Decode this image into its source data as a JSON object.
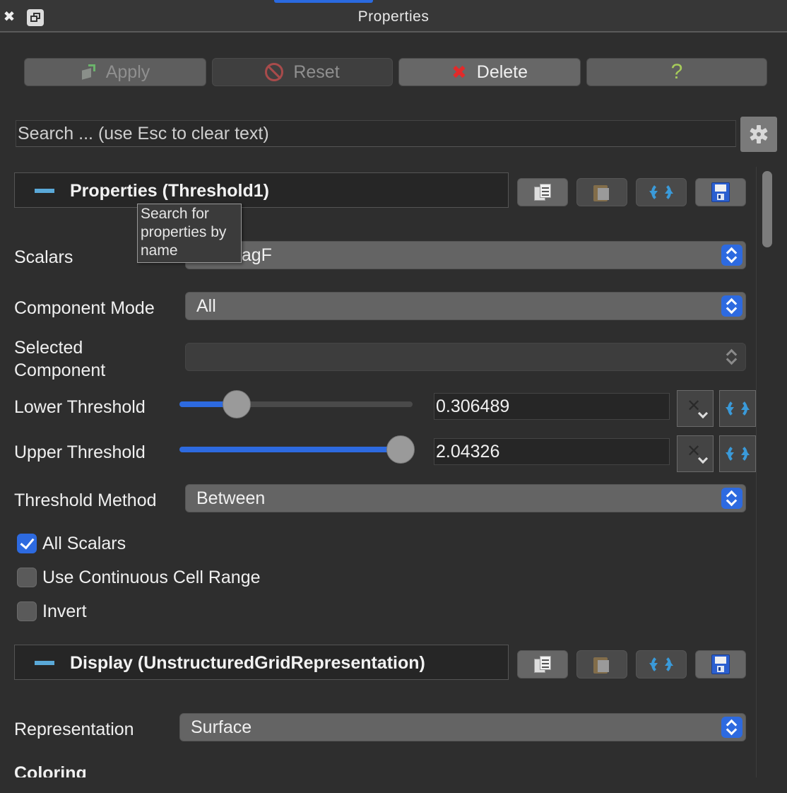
{
  "window": {
    "title": "Properties",
    "close_glyph": "✖"
  },
  "toolbar": {
    "apply_label": "Apply",
    "reset_label": "Reset",
    "delete_label": "Delete",
    "help_label": "?",
    "delete_glyph": "✖"
  },
  "search": {
    "placeholder": "Search ... (use Esc to clear text)",
    "value": ""
  },
  "tooltip": {
    "text": "Search for properties by name"
  },
  "properties_section": {
    "title": "Properties (Threshold1)",
    "scalars_label": "Scalars",
    "scalars_value": "magF",
    "component_mode_label": "Component Mode",
    "component_mode_value": "All",
    "selected_component_label": "Selected Component",
    "selected_component_value": "",
    "lower_threshold_label": "Lower Threshold",
    "lower_threshold_value": "0.306489",
    "lower_threshold_fraction": 0.19,
    "upper_threshold_label": "Upper Threshold",
    "upper_threshold_value": "2.04326",
    "upper_threshold_fraction": 0.94,
    "threshold_method_label": "Threshold Method",
    "threshold_method_value": "Between",
    "all_scalars_label": "All Scalars",
    "all_scalars_checked": true,
    "continuous_cell_range_label": "Use Continuous Cell Range",
    "continuous_cell_range_checked": false,
    "invert_label": "Invert",
    "invert_checked": false
  },
  "display_section": {
    "title": "Display (UnstructuredGridRepresentation)",
    "representation_label": "Representation",
    "representation_value": "Surface",
    "coloring_label": "Coloring"
  },
  "colors": {
    "accent": "#2d6ae0",
    "section_minus": "#5aa9d8",
    "delete_red": "#e22a2a",
    "help_green": "#a7cc5a"
  }
}
